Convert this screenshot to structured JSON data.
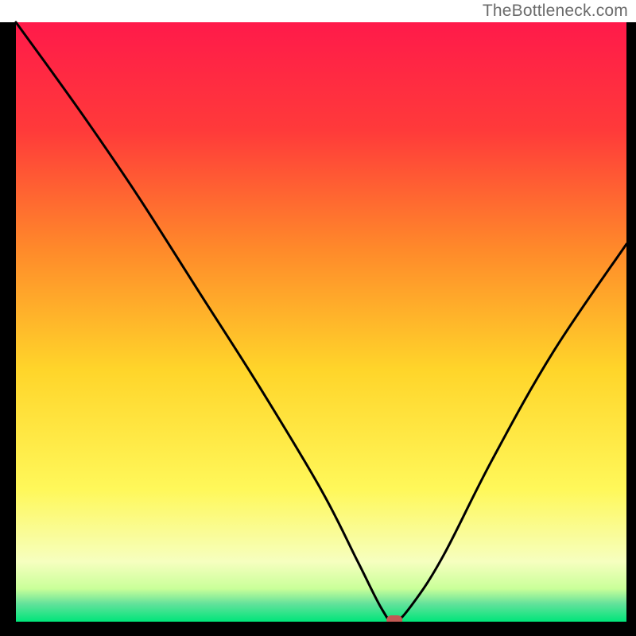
{
  "brand": {
    "label": "TheBottleneck.com"
  },
  "chart_data": {
    "type": "line",
    "title": "",
    "xlabel": "",
    "ylabel": "",
    "xlim": [
      0,
      100
    ],
    "ylim": [
      0,
      100
    ],
    "grid": false,
    "legend": false,
    "marker": {
      "x": 62,
      "y": 0,
      "color": "#c25a54"
    },
    "series": [
      {
        "name": "bottleneck-curve",
        "x": [
          0,
          5,
          12,
          20,
          30,
          40,
          50,
          56,
          60,
          62,
          65,
          70,
          78,
          88,
          100
        ],
        "y": [
          100,
          93,
          83,
          71,
          55,
          39,
          22,
          10,
          2,
          0,
          3,
          11,
          27,
          45,
          63
        ]
      }
    ],
    "background_gradient": {
      "stops": [
        {
          "offset": 0.0,
          "color": "#ff1a4a"
        },
        {
          "offset": 0.18,
          "color": "#ff3a3a"
        },
        {
          "offset": 0.38,
          "color": "#ff8a2a"
        },
        {
          "offset": 0.58,
          "color": "#ffd52a"
        },
        {
          "offset": 0.78,
          "color": "#fff85a"
        },
        {
          "offset": 0.9,
          "color": "#f6ffbf"
        },
        {
          "offset": 0.945,
          "color": "#c9ff99"
        },
        {
          "offset": 0.97,
          "color": "#64e29b"
        },
        {
          "offset": 1.0,
          "color": "#00e57a"
        }
      ]
    }
  }
}
